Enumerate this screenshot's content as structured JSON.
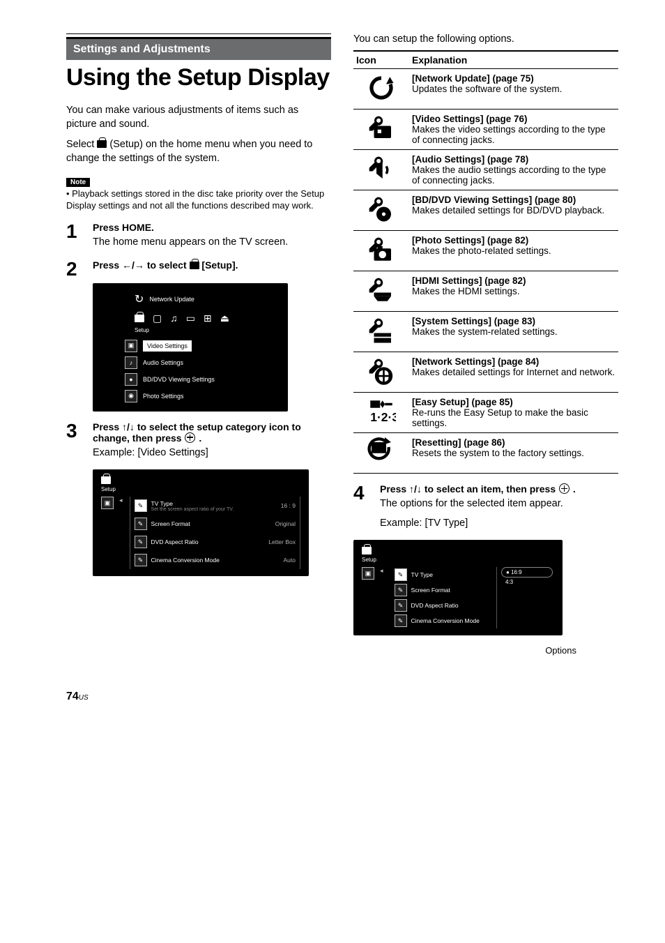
{
  "header": {
    "section_banner": "Settings and Adjustments",
    "main_title": "Using the Setup Display"
  },
  "intro": {
    "p1": "You can make various adjustments of items such as picture and sound.",
    "p2_before": "Select ",
    "p2_after": " (Setup) on the home menu when you need to change the settings of the system."
  },
  "note": {
    "label": "Note",
    "body": "Playback settings stored in the disc take priority over the Setup Display settings and not all the functions described may work."
  },
  "steps": {
    "1": {
      "heading": "Press HOME.",
      "body": "The home menu appears on the TV screen."
    },
    "2": {
      "heading_before": "Press ",
      "heading_arrows": "←/→",
      "heading_mid": " to select ",
      "heading_after": " [Setup]."
    },
    "3": {
      "heading_before": "Press ",
      "heading_arrows": "↑/↓",
      "heading_mid": " to select the setup category icon to change, then press ",
      "heading_after": " .",
      "body": "Example: [Video Settings]"
    },
    "4": {
      "heading_before": "Press ",
      "heading_arrows": "↑/↓",
      "heading_mid": " to select an item, then press ",
      "heading_after": " .",
      "body": "The options for the selected item appear.",
      "body2": "Example: [TV Type]"
    }
  },
  "screenshot2": {
    "network_update": "Network Update",
    "setup": "Setup",
    "video_settings": "Video Settings",
    "audio_settings": "Audio Settings",
    "bd_dvd": "BD/DVD Viewing Settings",
    "photo_settings": "Photo Settings"
  },
  "screenshot3": {
    "setup": "Setup",
    "rows": [
      {
        "label": "TV Type",
        "sub": "Set the screen aspect ratio of your TV.",
        "value": "16 : 9",
        "selected": true
      },
      {
        "label": "Screen Format",
        "value": "Original"
      },
      {
        "label": "DVD Aspect Ratio",
        "value": "Letter Box"
      },
      {
        "label": "Cinema Conversion Mode",
        "value": "Auto"
      }
    ]
  },
  "screenshot4": {
    "setup": "Setup",
    "rows": [
      {
        "label": "TV Type",
        "selected": true
      },
      {
        "label": "Screen Format"
      },
      {
        "label": "DVD Aspect Ratio"
      },
      {
        "label": "Cinema Conversion Mode"
      }
    ],
    "options": [
      {
        "label": "16:9",
        "selected": true
      },
      {
        "label": "4:3"
      }
    ],
    "caption": "Options"
  },
  "right_intro": "You can setup the following options.",
  "explain_table": {
    "header": {
      "icon": "Icon",
      "explanation": "Explanation"
    },
    "rows": [
      {
        "icon": "network-update",
        "title": "[Network Update] (page 75)",
        "desc": "Updates the software of the system."
      },
      {
        "icon": "video-settings",
        "title": "[Video Settings] (page 76)",
        "desc": "Makes the video settings according to the type of connecting jacks."
      },
      {
        "icon": "audio-settings",
        "title": "[Audio Settings] (page 78)",
        "desc": "Makes the audio settings according to the type of connecting jacks."
      },
      {
        "icon": "bd-dvd-settings",
        "title": "[BD/DVD Viewing Settings] (page 80)",
        "desc": "Makes detailed settings for BD/DVD playback."
      },
      {
        "icon": "photo-settings",
        "title": "[Photo Settings] (page 82)",
        "desc": "Makes the photo-related settings."
      },
      {
        "icon": "hdmi-settings",
        "title": "[HDMI Settings] (page 82)",
        "desc": "Makes the HDMI settings."
      },
      {
        "icon": "system-settings",
        "title": "[System Settings] (page 83)",
        "desc": "Makes the system-related settings."
      },
      {
        "icon": "network-settings",
        "title": "[Network Settings] (page 84)",
        "desc": "Makes detailed settings for Internet and network."
      },
      {
        "icon": "easy-setup",
        "title": "[Easy Setup] (page 85)",
        "desc": "Re-runs the Easy Setup to make the basic settings."
      },
      {
        "icon": "resetting",
        "title": "[Resetting] (page 86)",
        "desc": "Resets the system to the factory settings."
      }
    ]
  },
  "page_number": "74",
  "page_region": "US"
}
